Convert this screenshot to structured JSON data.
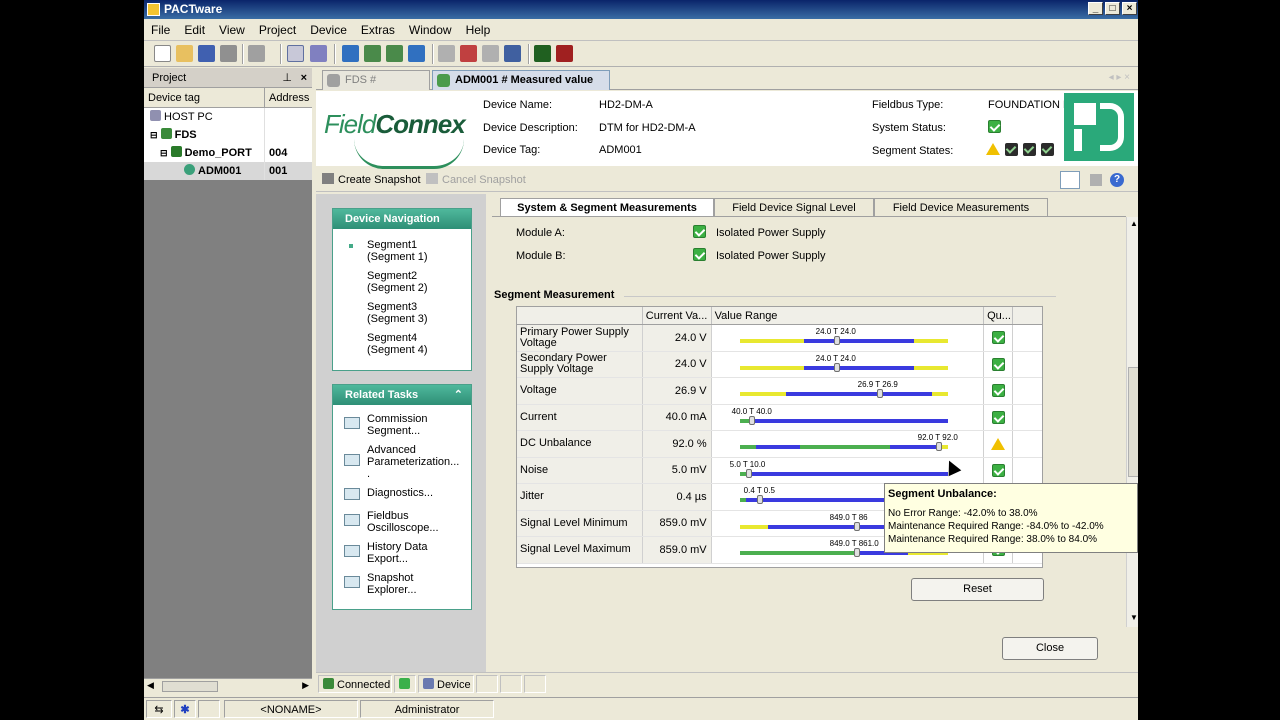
{
  "window": {
    "title": "PACTware"
  },
  "menu": [
    "File",
    "Edit",
    "View",
    "Project",
    "Device",
    "Extras",
    "Window",
    "Help"
  ],
  "project": {
    "title": "Project",
    "col_tag": "Device tag",
    "col_addr": "Address",
    "rows": [
      {
        "tag": "HOST PC",
        "addr": ""
      },
      {
        "tag": "FDS",
        "addr": ""
      },
      {
        "tag": "Demo_PORT",
        "addr": "004"
      },
      {
        "tag": "ADM001",
        "addr": "001"
      }
    ]
  },
  "tabs": [
    {
      "label": "FDS # Diagnosis"
    },
    {
      "label": "ADM001 # Measured value"
    }
  ],
  "device": {
    "name_label": "Device Name:",
    "name": "HD2-DM-A",
    "desc_label": "Device Description:",
    "desc": "DTM for HD2-DM-A",
    "tag_label": "Device Tag:",
    "tag": "ADM001",
    "fieldbus_label": "Fieldbus Type:",
    "fieldbus": "FOUNDATION F",
    "system_label": "System Status:",
    "segment_label": "Segment States:",
    "logo_text_1": "Field",
    "logo_text_2": "Connex"
  },
  "snapshot": {
    "create": "Create Snapshot",
    "cancel": "Cancel Snapshot"
  },
  "navigation": {
    "title": "Device Navigation",
    "items": [
      {
        "l1": "Segment1",
        "l2": "(Segment 1)"
      },
      {
        "l1": "Segment2",
        "l2": "(Segment 2)"
      },
      {
        "l1": "Segment3",
        "l2": "(Segment 3)"
      },
      {
        "l1": "Segment4",
        "l2": "(Segment 4)"
      }
    ]
  },
  "tasks": {
    "title": "Related Tasks",
    "items": [
      {
        "l1": "Commission",
        "l2": "Segment..."
      },
      {
        "l1": "Advanced",
        "l2": "Parameterization...",
        "l3": "."
      },
      {
        "l1": "Diagnostics...",
        "l2": ""
      },
      {
        "l1": "Fieldbus",
        "l2": "Oscilloscope..."
      },
      {
        "l1": "History Data",
        "l2": "Export..."
      },
      {
        "l1": "Snapshot",
        "l2": "Explorer..."
      }
    ]
  },
  "subtabs": [
    "System & Segment Measurements",
    "Field Device Signal Level",
    "Field Device Measurements"
  ],
  "modules": [
    {
      "label": "Module A:",
      "value": "Isolated Power Supply"
    },
    {
      "label": "Module B:",
      "value": "Isolated Power Supply"
    }
  ],
  "segment_title": "Segment Measurement",
  "grid_headers": [
    "",
    "Current Va...",
    "Value Range",
    "Qu..."
  ],
  "measurements": [
    {
      "name": "Primary Power Supply Voltage",
      "value": "24.0 V",
      "label": "24.0 T 24.0",
      "status": "ok"
    },
    {
      "name": "Secondary Power Supply Voltage",
      "value": "24.0 V",
      "label": "24.0 T 24.0",
      "status": "ok"
    },
    {
      "name": "Voltage",
      "value": "26.9 V",
      "label": "26.9 T 26.9",
      "status": "ok"
    },
    {
      "name": "Current",
      "value": "40.0 mA",
      "label": "40.0 T 40.0",
      "status": "ok"
    },
    {
      "name": "DC Unbalance",
      "value": "92.0 %",
      "label": "92.0 T 92.0",
      "status": "warn"
    },
    {
      "name": "Noise",
      "value": "5.0 mV",
      "label": "5.0 T 10.0",
      "status": "ok"
    },
    {
      "name": "Jitter",
      "value": "0.4 µs",
      "label": "0.4 T 0.5",
      "status": "ok"
    },
    {
      "name": "Signal Level Minimum",
      "value": "859.0 mV",
      "label": "849.0 T 86",
      "status": "ok"
    },
    {
      "name": "Signal Level Maximum",
      "value": "859.0 mV",
      "label": "849.0 T 861.0",
      "status": "ok"
    }
  ],
  "buttons": {
    "reset": "Reset",
    "close": "Close"
  },
  "tooltip": {
    "title": "Segment Unbalance:",
    "l1": "No Error Range: -42.0% to 38.0%",
    "l2": "Maintenance Required Range: -84.0% to -42.0%",
    "l3": "Maintenance Required Range: 38.0% to 84.0%"
  },
  "status": {
    "connected": "Connected",
    "device": "Device"
  },
  "bottom": {
    "project": "<NONAME>",
    "user": "Administrator"
  },
  "colors": {
    "yellow": "#e8e830",
    "blue": "#3a3adf",
    "green": "#4caf50",
    "accent": "#2aa97a"
  }
}
